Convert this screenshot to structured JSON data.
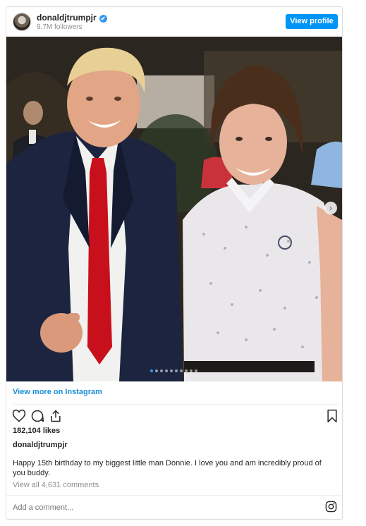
{
  "header": {
    "username": "donaldjtrumpjr",
    "verified_mark": "✔",
    "followers": "9.7M followers",
    "view_profile_label": "View profile"
  },
  "carousel": {
    "dot_count": 10,
    "active_dot": 0,
    "next_icon": "chevron-right-icon"
  },
  "view_more_label": "View more on Instagram",
  "actions": {
    "icons": [
      "heart-icon",
      "comment-icon",
      "share-icon",
      "bookmark-icon"
    ]
  },
  "likes": "182,104 likes",
  "caption": {
    "username": "donaldjtrumpjr",
    "text": "Happy 15th birthday to my biggest little man Donnie. I love you and am incredibly proud of you buddy."
  },
  "comments_link": "View all 4,631 comments",
  "add_comment": {
    "placeholder": "Add a comment..."
  },
  "colors": {
    "accent": "#0095f6",
    "link": "#1a8fd6",
    "tie": "#c8101c",
    "suit": "#1c2440"
  }
}
